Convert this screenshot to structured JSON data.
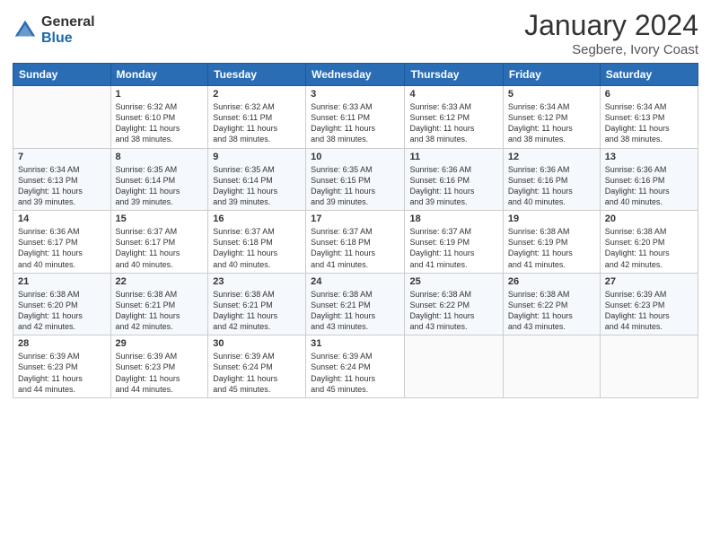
{
  "logo": {
    "general": "General",
    "blue": "Blue"
  },
  "header": {
    "month": "January 2024",
    "location": "Segbere, Ivory Coast"
  },
  "days_of_week": [
    "Sunday",
    "Monday",
    "Tuesday",
    "Wednesday",
    "Thursday",
    "Friday",
    "Saturday"
  ],
  "weeks": [
    [
      {
        "day": "",
        "info": ""
      },
      {
        "day": "1",
        "info": "Sunrise: 6:32 AM\nSunset: 6:10 PM\nDaylight: 11 hours\nand 38 minutes."
      },
      {
        "day": "2",
        "info": "Sunrise: 6:32 AM\nSunset: 6:11 PM\nDaylight: 11 hours\nand 38 minutes."
      },
      {
        "day": "3",
        "info": "Sunrise: 6:33 AM\nSunset: 6:11 PM\nDaylight: 11 hours\nand 38 minutes."
      },
      {
        "day": "4",
        "info": "Sunrise: 6:33 AM\nSunset: 6:12 PM\nDaylight: 11 hours\nand 38 minutes."
      },
      {
        "day": "5",
        "info": "Sunrise: 6:34 AM\nSunset: 6:12 PM\nDaylight: 11 hours\nand 38 minutes."
      },
      {
        "day": "6",
        "info": "Sunrise: 6:34 AM\nSunset: 6:13 PM\nDaylight: 11 hours\nand 38 minutes."
      }
    ],
    [
      {
        "day": "7",
        "info": "Sunrise: 6:34 AM\nSunset: 6:13 PM\nDaylight: 11 hours\nand 39 minutes."
      },
      {
        "day": "8",
        "info": "Sunrise: 6:35 AM\nSunset: 6:14 PM\nDaylight: 11 hours\nand 39 minutes."
      },
      {
        "day": "9",
        "info": "Sunrise: 6:35 AM\nSunset: 6:14 PM\nDaylight: 11 hours\nand 39 minutes."
      },
      {
        "day": "10",
        "info": "Sunrise: 6:35 AM\nSunset: 6:15 PM\nDaylight: 11 hours\nand 39 minutes."
      },
      {
        "day": "11",
        "info": "Sunrise: 6:36 AM\nSunset: 6:16 PM\nDaylight: 11 hours\nand 39 minutes."
      },
      {
        "day": "12",
        "info": "Sunrise: 6:36 AM\nSunset: 6:16 PM\nDaylight: 11 hours\nand 40 minutes."
      },
      {
        "day": "13",
        "info": "Sunrise: 6:36 AM\nSunset: 6:16 PM\nDaylight: 11 hours\nand 40 minutes."
      }
    ],
    [
      {
        "day": "14",
        "info": "Sunrise: 6:36 AM\nSunset: 6:17 PM\nDaylight: 11 hours\nand 40 minutes."
      },
      {
        "day": "15",
        "info": "Sunrise: 6:37 AM\nSunset: 6:17 PM\nDaylight: 11 hours\nand 40 minutes."
      },
      {
        "day": "16",
        "info": "Sunrise: 6:37 AM\nSunset: 6:18 PM\nDaylight: 11 hours\nand 40 minutes."
      },
      {
        "day": "17",
        "info": "Sunrise: 6:37 AM\nSunset: 6:18 PM\nDaylight: 11 hours\nand 41 minutes."
      },
      {
        "day": "18",
        "info": "Sunrise: 6:37 AM\nSunset: 6:19 PM\nDaylight: 11 hours\nand 41 minutes."
      },
      {
        "day": "19",
        "info": "Sunrise: 6:38 AM\nSunset: 6:19 PM\nDaylight: 11 hours\nand 41 minutes."
      },
      {
        "day": "20",
        "info": "Sunrise: 6:38 AM\nSunset: 6:20 PM\nDaylight: 11 hours\nand 42 minutes."
      }
    ],
    [
      {
        "day": "21",
        "info": "Sunrise: 6:38 AM\nSunset: 6:20 PM\nDaylight: 11 hours\nand 42 minutes."
      },
      {
        "day": "22",
        "info": "Sunrise: 6:38 AM\nSunset: 6:21 PM\nDaylight: 11 hours\nand 42 minutes."
      },
      {
        "day": "23",
        "info": "Sunrise: 6:38 AM\nSunset: 6:21 PM\nDaylight: 11 hours\nand 42 minutes."
      },
      {
        "day": "24",
        "info": "Sunrise: 6:38 AM\nSunset: 6:21 PM\nDaylight: 11 hours\nand 43 minutes."
      },
      {
        "day": "25",
        "info": "Sunrise: 6:38 AM\nSunset: 6:22 PM\nDaylight: 11 hours\nand 43 minutes."
      },
      {
        "day": "26",
        "info": "Sunrise: 6:38 AM\nSunset: 6:22 PM\nDaylight: 11 hours\nand 43 minutes."
      },
      {
        "day": "27",
        "info": "Sunrise: 6:39 AM\nSunset: 6:23 PM\nDaylight: 11 hours\nand 44 minutes."
      }
    ],
    [
      {
        "day": "28",
        "info": "Sunrise: 6:39 AM\nSunset: 6:23 PM\nDaylight: 11 hours\nand 44 minutes."
      },
      {
        "day": "29",
        "info": "Sunrise: 6:39 AM\nSunset: 6:23 PM\nDaylight: 11 hours\nand 44 minutes."
      },
      {
        "day": "30",
        "info": "Sunrise: 6:39 AM\nSunset: 6:24 PM\nDaylight: 11 hours\nand 45 minutes."
      },
      {
        "day": "31",
        "info": "Sunrise: 6:39 AM\nSunset: 6:24 PM\nDaylight: 11 hours\nand 45 minutes."
      },
      {
        "day": "",
        "info": ""
      },
      {
        "day": "",
        "info": ""
      },
      {
        "day": "",
        "info": ""
      }
    ]
  ]
}
